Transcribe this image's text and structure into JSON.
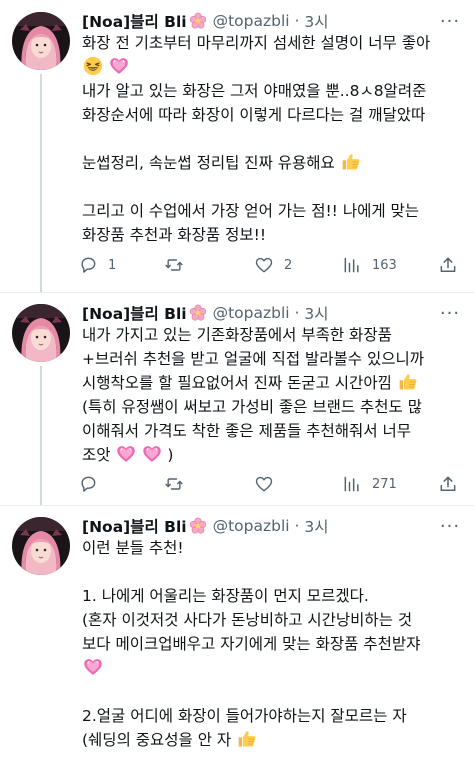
{
  "tweets": [
    {
      "author": {
        "name": "[Noa]블리 Bli",
        "handle": "@topazbli",
        "time": "3시"
      },
      "lines": [
        "화장 전 기초부터 마무리까지 섬세한 설명이 너무 좋아",
        "",
        "내가 알고 있는 화장은 그저 야매였을 뿐..8ㅅ8알려준",
        "화장순서에 따라 화장이 이렇게 다르다는 걸 깨달았따",
        "",
        "눈썹정리, 속눈썹 정리팁 진짜 유용해요",
        "",
        "그리고 이 수업에서 가장 얻어 가는 점!! 나에게 맞는",
        "화장품 추천과 화장품 정보!!"
      ],
      "counts": {
        "reply": "1",
        "retweet": "",
        "like": "2",
        "views": "163"
      }
    },
    {
      "author": {
        "name": "[Noa]블리 Bli",
        "handle": "@topazbli",
        "time": "3시"
      },
      "lines": [
        "내가 가지고 있는 기존화장품에서  부족한  화장품",
        "+브러쉬 추천을 받고 얼굴에 직접 발라볼수 있으니까",
        "시행착오를 할 필요없어서 진짜 돈굳고 시간아낌",
        "(특히 유정쌤이 써보고 가성비 좋은 브랜드 추천도 많",
        "이해줘서 가격도 착한 좋은 제품들 추천해줘서 너무",
        "조앗"
      ],
      "counts": {
        "reply": "",
        "retweet": "",
        "like": "",
        "views": "271"
      }
    },
    {
      "author": {
        "name": "[Noa]블리 Bli",
        "handle": "@topazbli",
        "time": "3시"
      },
      "lines": [
        "이런 분들 추천!",
        "",
        "1. 나에게 어울리는 화장품이 먼지 모르겠다.",
        "(혼자 이것저것 사다가 돈낭비하고 시간낭비하는 것",
        "보다 메이크업배우고 자기에게 맞는 화장품 추천받쟈",
        "",
        "",
        "2.얼굴 어디에 화장이 들어가야하는지 잘모르는 자",
        "(쉐딩의 중요성을 안 자"
      ],
      "counts": {}
    }
  ],
  "icons": {
    "author_badge": "cherry-blossom-emoji",
    "reply": "reply-icon",
    "retweet": "retweet-icon",
    "like": "heart-icon",
    "views": "views-icon",
    "share": "share-icon"
  },
  "colors": {
    "text": "#0f1419",
    "secondary": "#536471",
    "divider": "#e6ecf0",
    "thread_line": "#cfd9de"
  }
}
